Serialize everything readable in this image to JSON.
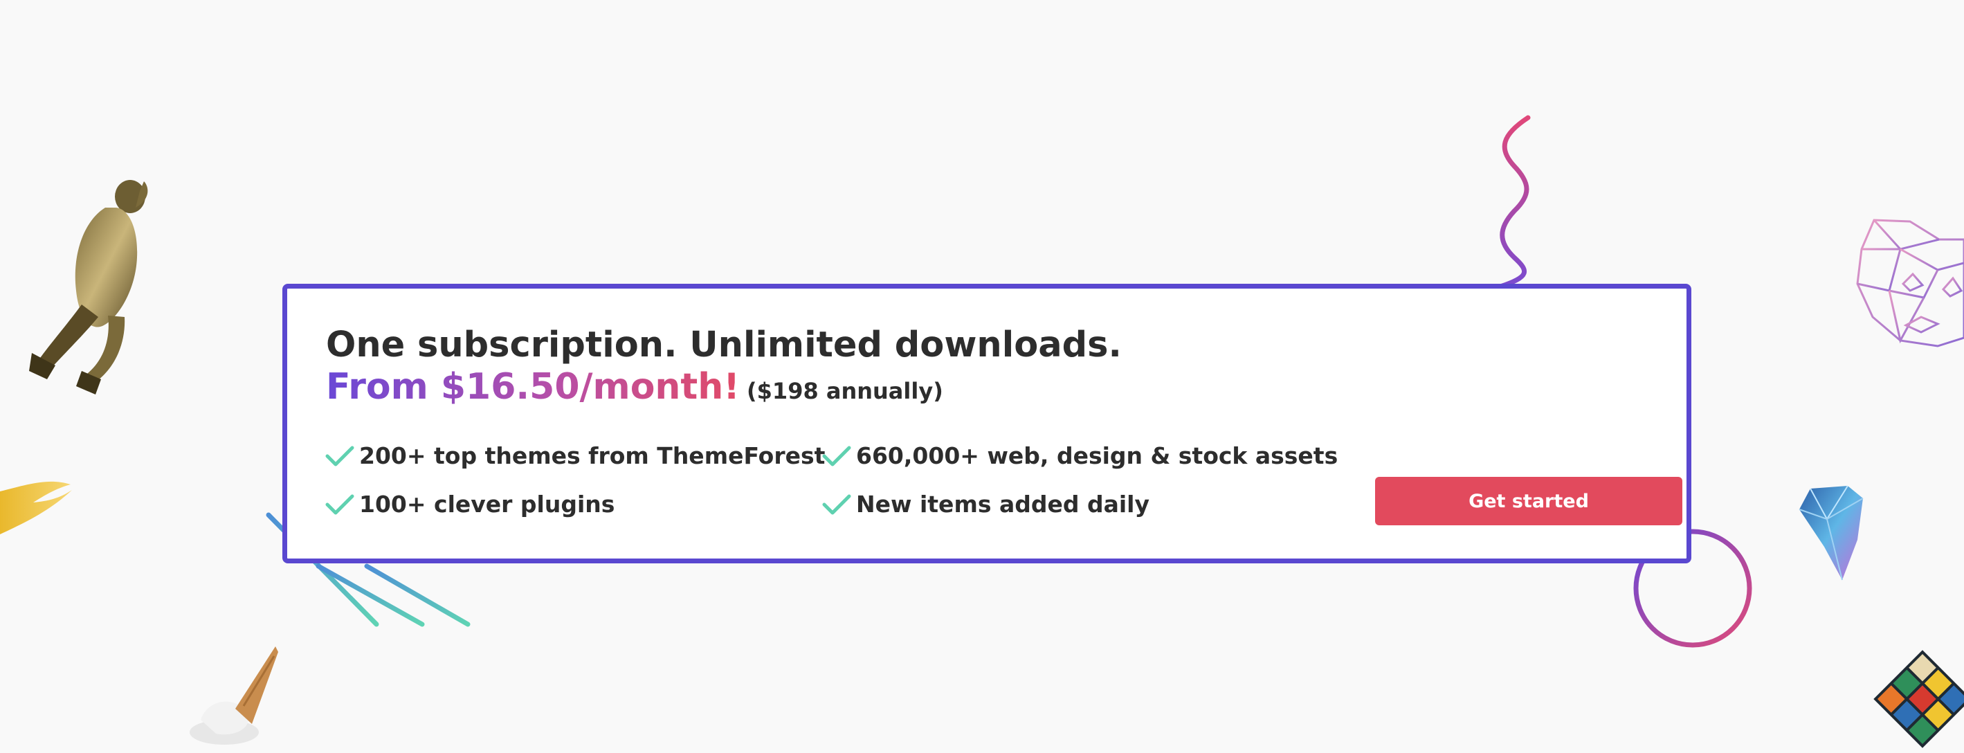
{
  "banner": {
    "headline": "One subscription. Unlimited downloads.",
    "price": "From $16.50/month!",
    "annual_price": "($198 annually)",
    "features": [
      "200+ top themes from ThemeForest",
      "660,000+ web, design & stock assets",
      "100+ clever plugins",
      "New items added daily"
    ],
    "cta_label": "Get started"
  },
  "decorations": {
    "icons": [
      "dancer-figure-icon",
      "gold-brush-stroke-icon",
      "ice-cream-cone-icon",
      "squiggle-line-icon",
      "diagonal-lines-icon",
      "circle-ring-icon",
      "geometric-bear-head-icon",
      "crystal-gem-icon",
      "rubiks-cube-icon",
      "check-icon"
    ]
  },
  "colors": {
    "card_border": "#5a48d0",
    "cta_background": "#e24a5d",
    "check": "#5fd1b0",
    "text": "#2d2d2d",
    "price_gradient_start": "#6a48d6",
    "price_gradient_end": "#e14a67",
    "background": "#f9f9f9"
  }
}
